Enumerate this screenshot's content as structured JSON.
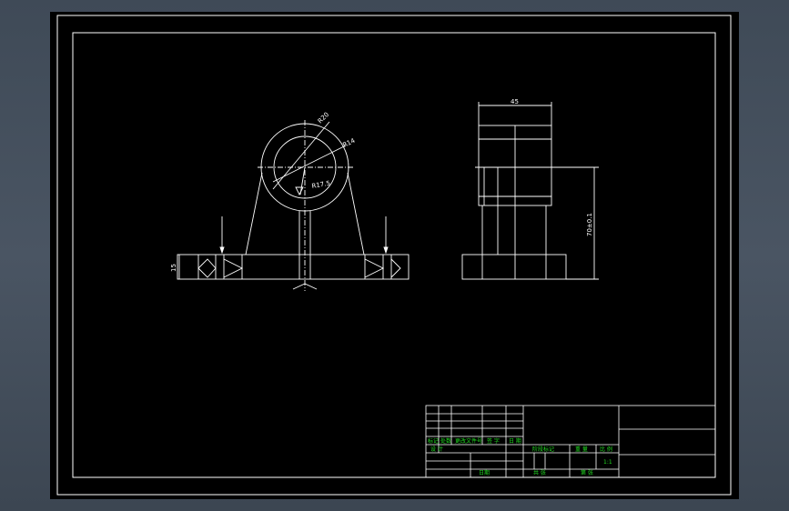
{
  "colors": {
    "background": "#000000",
    "line": "#ffffff",
    "hidden_line": "#ffffff",
    "centerline": "#ffffff",
    "titleblock_text": "#22dd22",
    "window_bg": "#44505d"
  },
  "front_view": {
    "dim_ring_od": "R20",
    "dim_ring_id": "R14",
    "dim_angle": "R17.5",
    "dim_base_height": "15"
  },
  "side_view": {
    "dim_width": "45",
    "dim_height": "70±0.1"
  },
  "title_block": {
    "row_labels": [
      "标记",
      "处数",
      "更改文件号",
      "签 字",
      "日 期"
    ],
    "design_label": "设 计",
    "stage_label": "阶段标记",
    "weight_label": "重 量",
    "scale_label": "比 例",
    "scale_value": "1:1",
    "approve_label": "日期",
    "sheet_label": "共  张",
    "sheet_of_label": "第  张"
  }
}
